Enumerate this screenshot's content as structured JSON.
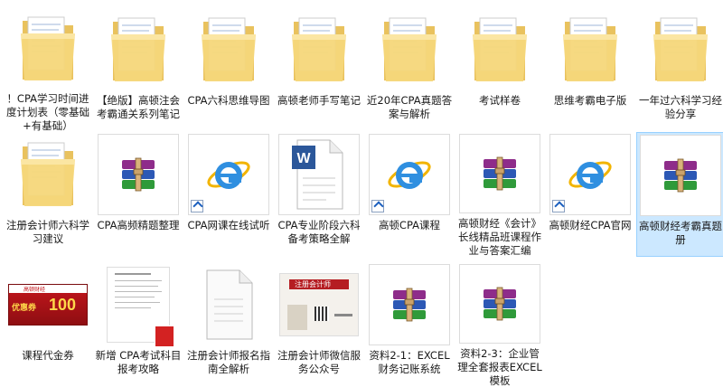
{
  "items": [
    {
      "label": "！CPA学习时间进度计划表（零基础+有基础）",
      "icon": "folder-icon",
      "selected": false
    },
    {
      "label": "【绝版】高顿注会考霸通关系列笔记",
      "icon": "folder-icon",
      "selected": false
    },
    {
      "label": "CPA六科思维导图",
      "icon": "folder-icon",
      "selected": false
    },
    {
      "label": "高顿老师手写笔记",
      "icon": "folder-icon",
      "selected": false
    },
    {
      "label": "近20年CPA真题答案与解析",
      "icon": "folder-icon",
      "selected": false
    },
    {
      "label": "考试样卷",
      "icon": "folder-icon",
      "selected": false
    },
    {
      "label": "思维考霸电子版",
      "icon": "folder-icon",
      "selected": false
    },
    {
      "label": "一年过六科学习经验分享",
      "icon": "folder-icon",
      "selected": false
    },
    {
      "label": "注册会计师六科学习建议",
      "icon": "folder-icon",
      "selected": false
    },
    {
      "label": "CPA高频精题整理",
      "icon": "rar-icon",
      "selected": false
    },
    {
      "label": "CPA网课在线试听",
      "icon": "ie-shortcut-icon",
      "selected": false
    },
    {
      "label": "CPA专业阶段六科备考策略全解",
      "icon": "word-icon",
      "selected": false
    },
    {
      "label": "高顿CPA课程",
      "icon": "ie-shortcut-icon",
      "selected": false
    },
    {
      "label": "高顿财经《会计》长线精品班课程作业与答案汇编",
      "icon": "rar-icon",
      "selected": false
    },
    {
      "label": "高顿财经CPA官网",
      "icon": "ie-shortcut-icon",
      "selected": false
    },
    {
      "label": "高顿财经考霸真题册",
      "icon": "rar-icon",
      "selected": true
    },
    {
      "label": "课程代金券",
      "icon": "voucher-image-icon",
      "selected": false
    },
    {
      "label": "新增 CPA考试科目报考攻略",
      "icon": "pdf-icon",
      "selected": false
    },
    {
      "label": "注册会计师报名指南全解析",
      "icon": "blank-document-icon",
      "selected": false
    },
    {
      "label": "注册会计师微信服务公众号",
      "icon": "wechat-image-icon",
      "selected": false
    },
    {
      "label": "资料2-1：EXCEL财务记账系统",
      "icon": "rar-icon",
      "selected": false
    },
    {
      "label": "资料2-3：企业管理全套报表EXCEL模板",
      "icon": "rar-icon",
      "selected": false
    }
  ],
  "voucher": {
    "brand": "高顿财经",
    "value": "100",
    "prefix": "优惠券"
  },
  "wechat_card": {
    "title": "注册会计师"
  },
  "colors": {
    "selected_bg": "#cce8ff",
    "selected_border": "#99d1ff",
    "folder": "#f5d77a"
  }
}
